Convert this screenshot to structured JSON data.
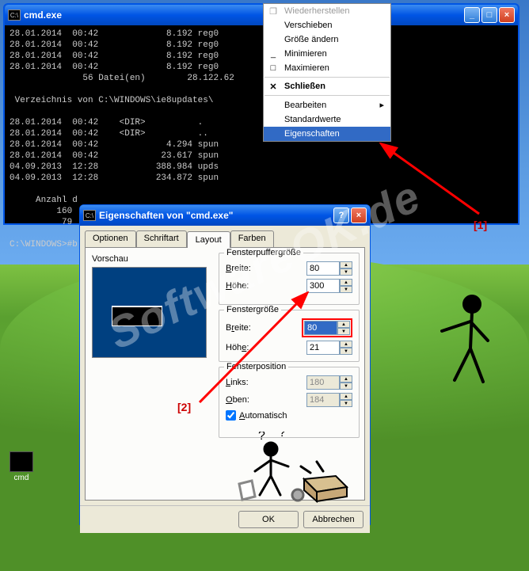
{
  "cmd": {
    "title": "cmd.exe",
    "lines": [
      "28.01.2014  00:42             8.192 reg0",
      "28.01.2014  00:42             8.192 reg0",
      "28.01.2014  00:42             8.192 reg0",
      "28.01.2014  00:42             8.192 reg0",
      "              56 Datei(en)        28.122.62",
      "",
      " Verzeichnis von C:\\WINDOWS\\ie8updates\\                   inst",
      "",
      "28.01.2014  00:42    <DIR>          .",
      "28.01.2014  00:42    <DIR>          ..",
      "28.01.2014  00:42             4.294 spun",
      "28.01.2014  00:42            23.617 spun",
      "04.09.2013  12:28           388.984 upds",
      "04.09.2013  12:28           234.872 spun",
      "",
      "     Anzahl d",
      "         160",
      "          79",
      "",
      "C:\\WINDOWS>#b"
    ],
    "icon_text": "C:\\"
  },
  "sysmenu": {
    "items": [
      {
        "label": "Wiederherstellen",
        "disabled": true,
        "icon": "restore"
      },
      {
        "label": "Verschieben",
        "icon": ""
      },
      {
        "label": "Größe ändern",
        "icon": ""
      },
      {
        "label": "Minimieren",
        "icon": "min"
      },
      {
        "label": "Maximieren",
        "icon": "max"
      },
      {
        "sep": true
      },
      {
        "label": "Schließen",
        "bold": true,
        "icon": "close"
      },
      {
        "sep": true
      },
      {
        "label": "Bearbeiten",
        "submenu": true
      },
      {
        "label": "Standardwerte"
      },
      {
        "label": "Eigenschaften",
        "highlighted": true
      }
    ]
  },
  "props": {
    "title": "Eigenschaften von \"cmd.exe\"",
    "tabs": [
      "Optionen",
      "Schriftart",
      "Layout",
      "Farben"
    ],
    "active_tab": "Layout",
    "preview": "Vorschau",
    "buffer": {
      "group": "Fensterpuffergröße",
      "width_label": "Breite:",
      "width_value": "80",
      "height_label": "Höhe:",
      "height_value": "300"
    },
    "winsize": {
      "group": "Fenstergröße",
      "width_label": "Breite:",
      "width_value": "80",
      "height_label": "Höhe:",
      "height_value": "21"
    },
    "winpos": {
      "group": "Fensterposition",
      "left_label": "Links:",
      "left_value": "180",
      "top_label": "Oben:",
      "top_value": "184",
      "auto_label": "Automatisch",
      "auto_checked": true
    },
    "ok": "OK",
    "cancel": "Abbrechen"
  },
  "annot": {
    "a1": "[1]",
    "a2": "[2]"
  },
  "watermark": "SoftwareOK.de",
  "desktop_icon": "cmd"
}
